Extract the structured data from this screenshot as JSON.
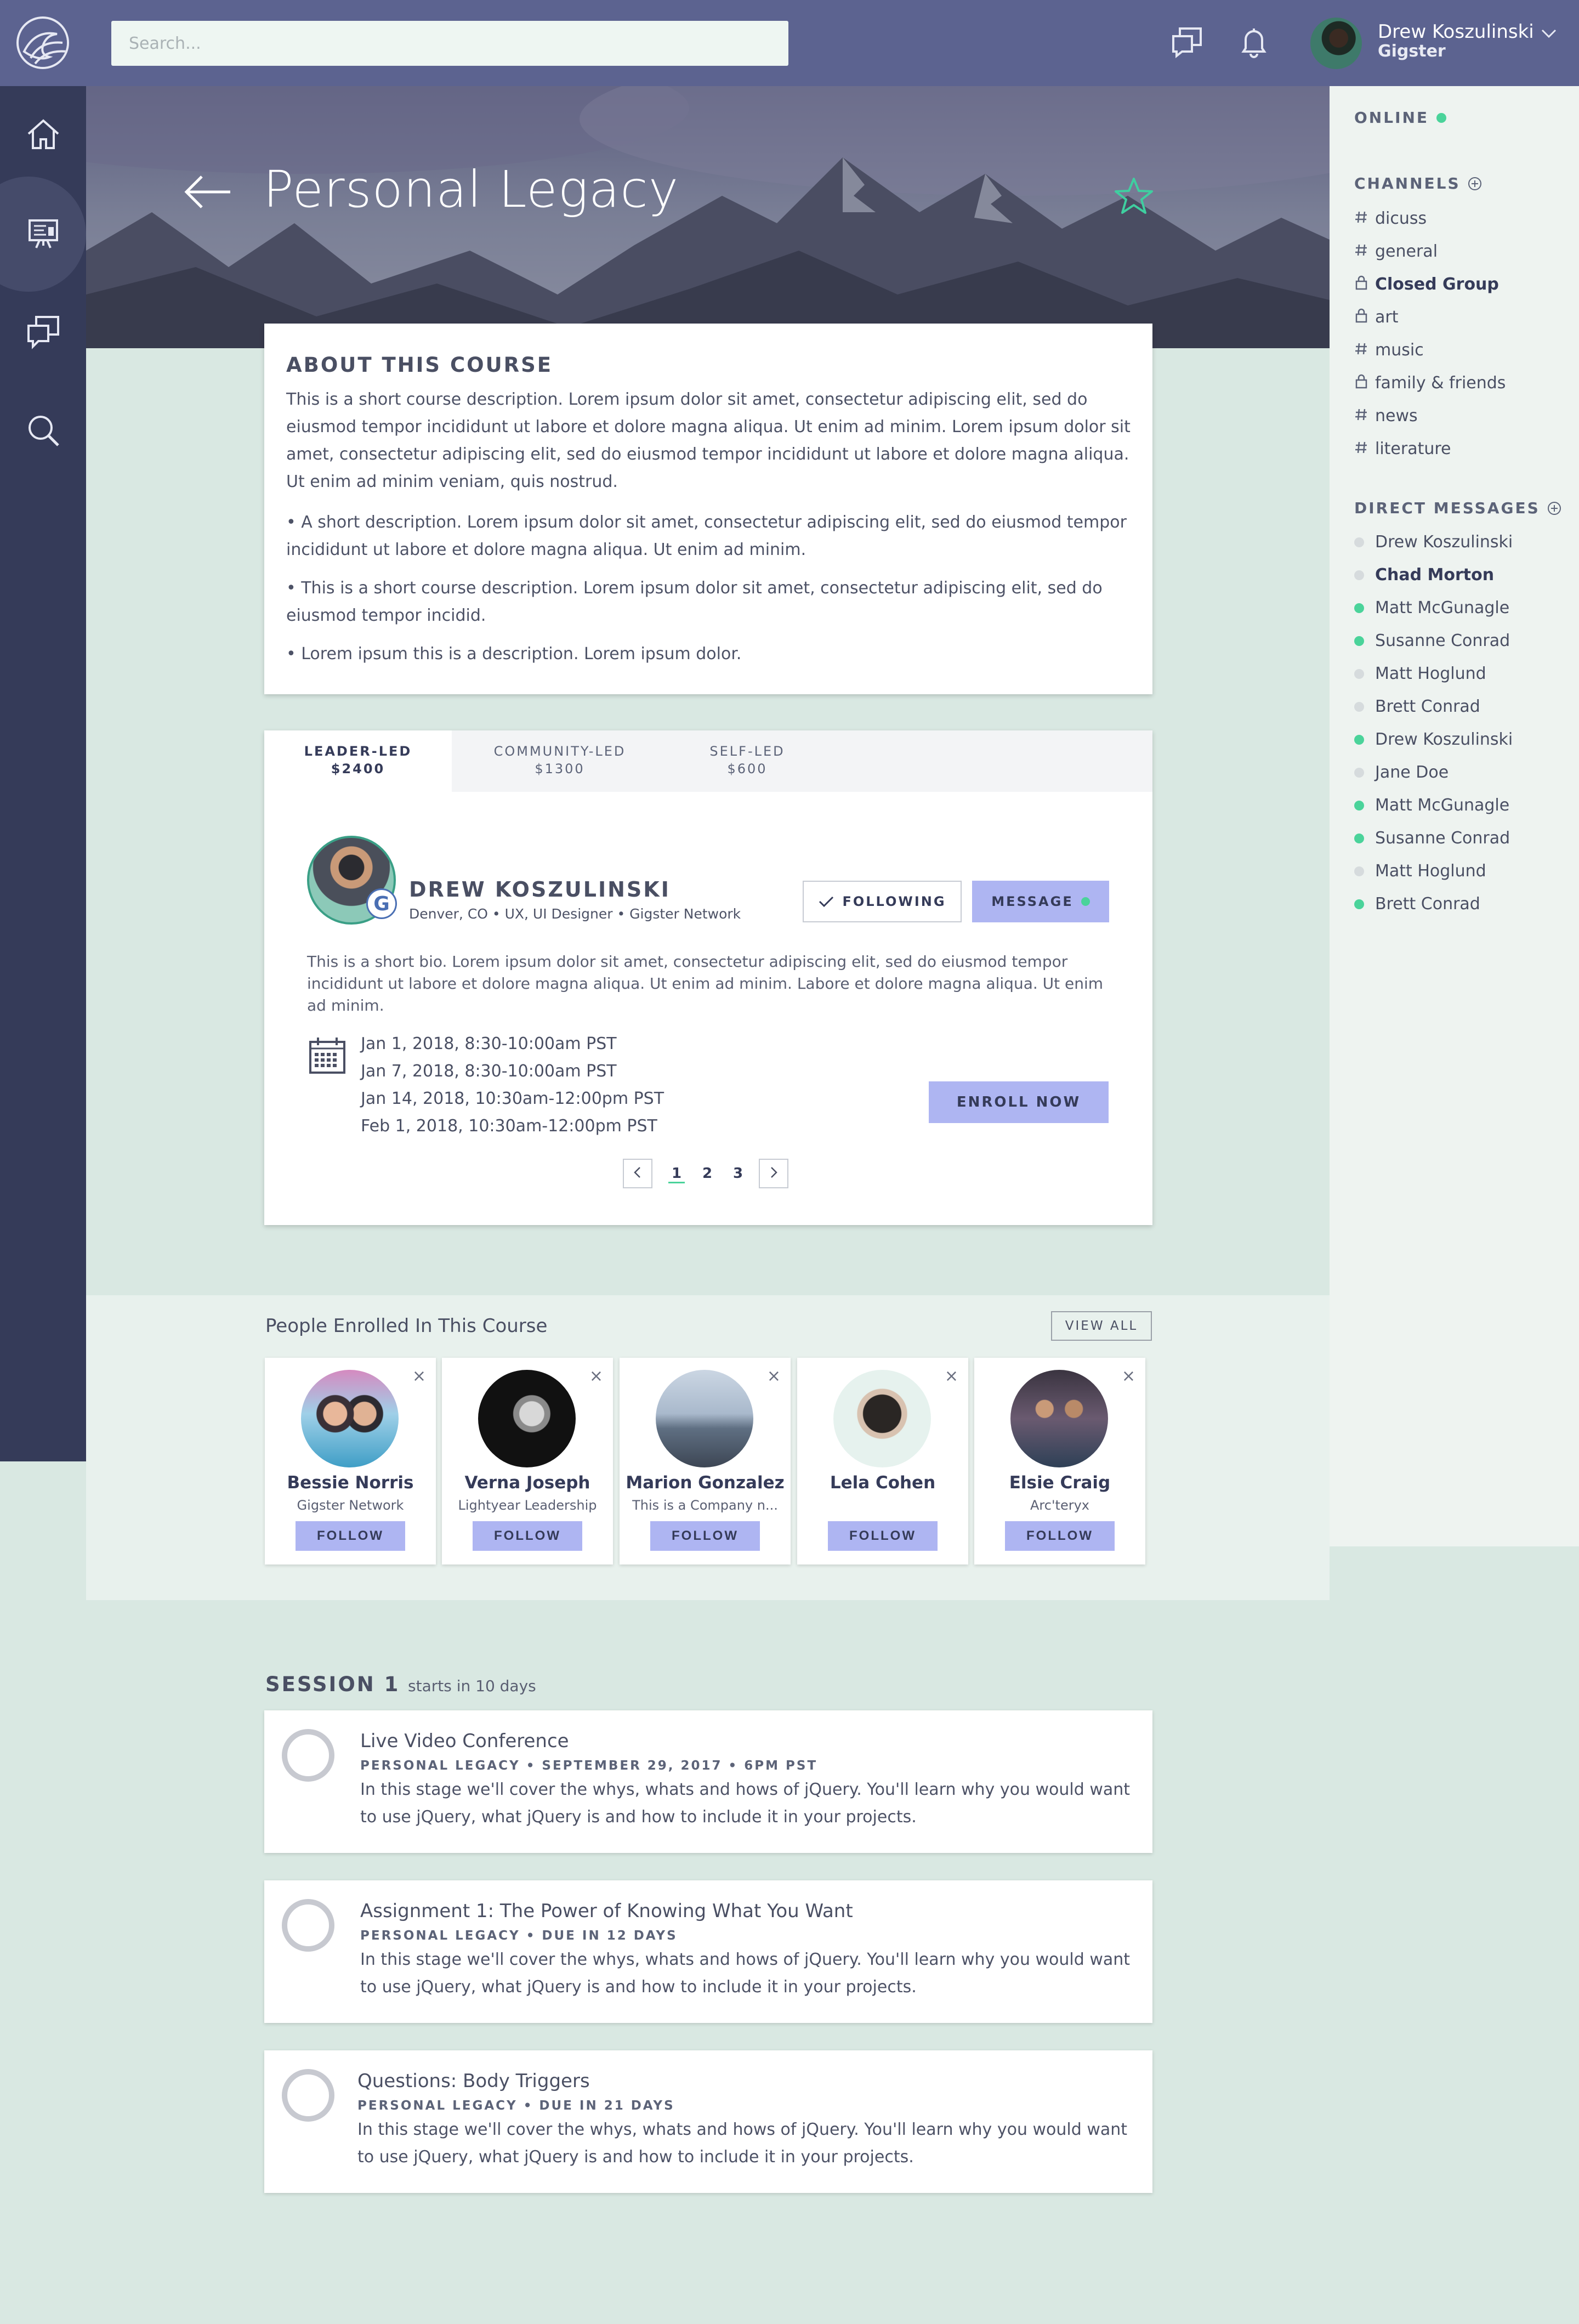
{
  "topbar": {
    "search_placeholder": "Search...",
    "user_name": "Drew Koszulinski",
    "user_role": "Gigster"
  },
  "hero": {
    "title": "Personal Legacy"
  },
  "about": {
    "title": "ABOUT THIS COURSE",
    "paragraphs": [
      "This is a short course description. Lorem ipsum dolor sit amet, consectetur adipiscing elit, sed do eiusmod tempor incididunt ut labore et dolore magna aliqua. Ut enim ad minim. Lorem ipsum dolor sit amet, consectetur adipiscing elit, sed do eiusmod tempor incididunt ut labore et dolore magna aliqua. Ut enim ad minim veniam, quis nostrud.",
      "• A short description. Lorem ipsum dolor sit amet, consectetur adipiscing elit, sed do eiusmod tempor incididunt ut labore et dolore magna aliqua. Ut enim ad minim.",
      "• This is a short course description. Lorem ipsum dolor sit amet, consectetur adipiscing elit, sed do eiusmod tempor incidid.",
      "• Lorem ipsum this is a description. Lorem ipsum dolor."
    ]
  },
  "course": {
    "tabs": [
      {
        "label": "LEADER-LED",
        "price": "$2400"
      },
      {
        "label": "COMMUNITY-LED",
        "price": "$1300"
      },
      {
        "label": "SELF-LED",
        "price": "$600"
      }
    ],
    "instructor": {
      "badge": "G",
      "name": "DREW KOSZULINSKI",
      "meta": "Denver, CO  •  UX, UI Designer  •  Gigster Network",
      "bio": "This is a short bio. Lorem ipsum dolor sit amet, consectetur adipiscing elit, sed do eiusmod tempor incididunt ut labore et dolore magna aliqua. Ut enim ad minim. Labore et dolore magna aliqua. Ut enim ad minim."
    },
    "following_label": "FOLLOWING",
    "message_label": "MESSAGE",
    "dates": [
      "Jan 1, 2018, 8:30-10:00am PST",
      "Jan 7, 2018, 8:30-10:00am PST",
      "Jan 14, 2018, 10:30am-12:00pm PST",
      "Feb 1, 2018, 10:30am-12:00pm PST"
    ],
    "enroll_label": "ENROLL NOW",
    "pages": [
      "1",
      "2",
      "3"
    ]
  },
  "enrolled": {
    "title": "People Enrolled In This Course",
    "view_all_label": "VIEW ALL",
    "follow_label": "FOLLOW",
    "close_glyph": "×",
    "people": [
      {
        "name": "Bessie Norris",
        "sub": "Gigster Network"
      },
      {
        "name": "Verna Joseph",
        "sub": "Lightyear Leadership"
      },
      {
        "name": "Marion Gonzalez",
        "sub": "This is a Company n..."
      },
      {
        "name": "Lela Cohen",
        "sub": ""
      },
      {
        "name": "Elsie Craig",
        "sub": "Arc'teryx"
      }
    ]
  },
  "session": {
    "title": "SESSION 1",
    "subtitle": "starts in 10 days",
    "tasks": [
      {
        "title": "Live Video Conference",
        "meta": "PERSONAL LEGACY  •  SEPTEMBER 29, 2017  •  6PM PST",
        "desc": "In this stage we'll cover the whys, whats and hows of jQuery. You'll learn why you would want to use jQuery, what jQuery is and how to include it in your projects."
      },
      {
        "title": "Assignment 1: The Power of Knowing What You Want",
        "meta": "PERSONAL LEGACY  •  DUE IN 12 DAYS",
        "desc": "In this stage we'll cover the whys, whats and hows of jQuery. You'll learn why you would want to use jQuery, what jQuery is and how to include it in your projects."
      },
      {
        "title": "Questions: Body Triggers",
        "meta": "PERSONAL LEGACY  •  DUE IN 21 DAYS",
        "desc": "In this stage we'll cover the whys, whats and hows of jQuery. You'll learn why you would want to use jQuery, what jQuery is and how to include it in your projects."
      }
    ]
  },
  "sidebar": {
    "online_label": "ONLINE",
    "channels_label": "CHANNELS",
    "channels": [
      {
        "name": "dicuss",
        "icon": "hash",
        "bold": false
      },
      {
        "name": "general",
        "icon": "hash",
        "bold": false
      },
      {
        "name": "Closed Group",
        "icon": "lock",
        "bold": true
      },
      {
        "name": "art",
        "icon": "lock",
        "bold": false
      },
      {
        "name": "music",
        "icon": "hash",
        "bold": false
      },
      {
        "name": "family & friends",
        "icon": "lock",
        "bold": false
      },
      {
        "name": "news",
        "icon": "hash",
        "bold": false
      },
      {
        "name": "literature",
        "icon": "hash",
        "bold": false
      }
    ],
    "dm_label": "DIRECT MESSAGES",
    "dms": [
      {
        "name": "Drew Koszulinski",
        "online": false,
        "bold": false
      },
      {
        "name": "Chad Morton",
        "online": false,
        "bold": true
      },
      {
        "name": "Matt McGunagle",
        "online": true,
        "bold": false
      },
      {
        "name": "Susanne Conrad",
        "online": true,
        "bold": false
      },
      {
        "name": "Matt Hoglund",
        "online": false,
        "bold": false
      },
      {
        "name": "Brett Conrad",
        "online": false,
        "bold": false
      },
      {
        "name": "Drew Koszulinski",
        "online": true,
        "bold": false
      },
      {
        "name": "Jane Doe",
        "online": false,
        "bold": false
      },
      {
        "name": "Matt McGunagle",
        "online": true,
        "bold": false
      },
      {
        "name": "Susanne Conrad",
        "online": true,
        "bold": false
      },
      {
        "name": "Matt Hoglund",
        "online": false,
        "bold": false
      },
      {
        "name": "Brett Conrad",
        "online": true,
        "bold": false
      }
    ]
  },
  "icons": {
    "logo": "wave-logo-icon",
    "home": "home-icon",
    "courses": "presentation-icon",
    "chat": "chat-icon",
    "search": "search-icon",
    "notifications": "bell-icon",
    "back": "back-arrow-icon",
    "favorite": "star-icon",
    "calendar": "calendar-icon"
  },
  "colors": {
    "topbar": "#5c6390",
    "leftnav": "#353b59",
    "accent_button": "#aeb5f2",
    "online": "#4ad39a",
    "star": "#3fcfa0",
    "background": "#d9e8e2"
  }
}
